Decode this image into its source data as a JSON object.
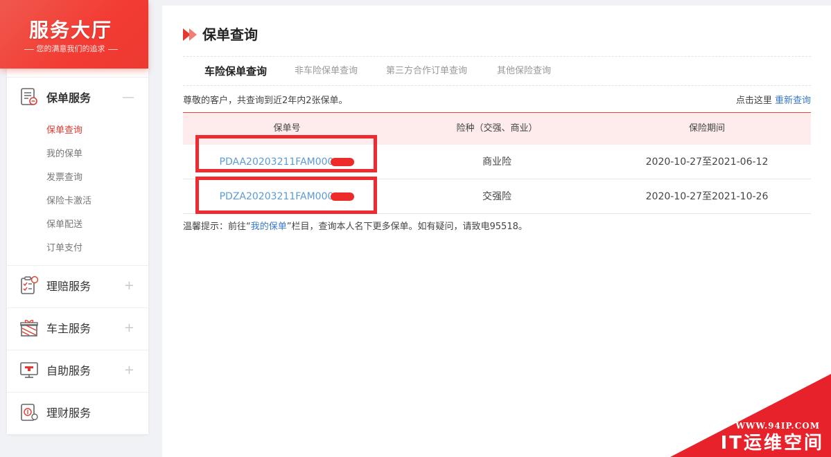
{
  "brand": {
    "title": "服务大厅",
    "subtitle": "您的满意我们的追求"
  },
  "sidebar": {
    "groups": [
      {
        "label": "保单服务",
        "icon": "policy-doc-icon",
        "toggle": "—",
        "expanded": true,
        "items": [
          {
            "label": "保单查询",
            "active": true
          },
          {
            "label": "我的保单"
          },
          {
            "label": "发票查询"
          },
          {
            "label": "保险卡激活"
          },
          {
            "label": "保单配送"
          },
          {
            "label": "订单支付"
          }
        ]
      },
      {
        "label": "理赔服务",
        "icon": "claims-clipboard-icon",
        "toggle": "+"
      },
      {
        "label": "车主服务",
        "icon": "gift-box-icon",
        "toggle": "+"
      },
      {
        "label": "自助服务",
        "icon": "monitor-icon",
        "toggle": "+"
      },
      {
        "label": "理财服务",
        "icon": "finance-icon"
      }
    ]
  },
  "main": {
    "title": "保单查询",
    "tabs": [
      {
        "label": "车险保单查询",
        "active": true
      },
      {
        "label": "非车险保单查询"
      },
      {
        "label": "第三方合作订单查询"
      },
      {
        "label": "其他保险查询"
      }
    ],
    "info": {
      "text": "尊敬的客户，共查询到近2年内2张保单。",
      "prompt": "点击这里",
      "requery_link": "重新查询"
    },
    "table": {
      "headers": [
        "保单号",
        "险种（交强、商业）",
        "保险期间"
      ],
      "rows": [
        {
          "policy_no": "PDAA20203211FAM000",
          "type": "商业险",
          "period": "2020-10-27至2021-06-12"
        },
        {
          "policy_no": "PDZA20203211FAM000",
          "type": "交强险",
          "period": "2020-10-27至2021-10-26"
        }
      ]
    },
    "tip": {
      "prefix": "温馨提示：前往“",
      "link": "我的保单",
      "suffix": "”栏目，查询本人名下更多保单。如有疑问，请致电95518。"
    }
  },
  "watermark": {
    "url": "WWW.94IP.COM",
    "name": "IT运维空间"
  },
  "colors": {
    "accent": "#e23a2f",
    "link": "#3a78c9",
    "policy_link": "#5b9bd5",
    "table_header_bg": "#fdeceb",
    "page_bg": "#f1f2f6"
  }
}
